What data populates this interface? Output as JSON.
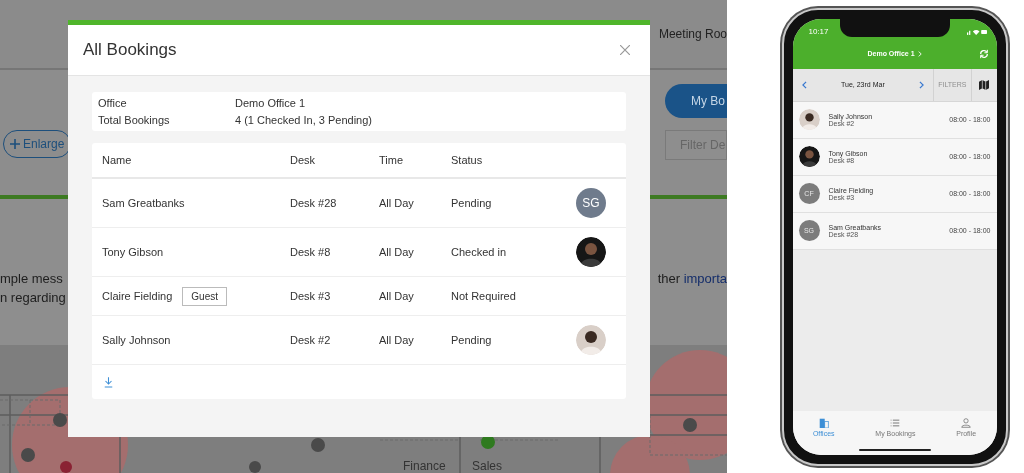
{
  "background_page": {
    "header_link": "Meeting Roo",
    "my_bookings_button": "My Bo",
    "enlarge_button": "Enlarge",
    "filter_field": {
      "placeholder": "Filter De"
    },
    "message_left": [
      "mple mess",
      "n regarding"
    ],
    "message_right": {
      "text": "ther",
      "link": "importa"
    },
    "floor_plan_labels": [
      "Finance",
      "Sales"
    ]
  },
  "modal": {
    "title": "All Bookings",
    "summary": [
      {
        "label": "Office",
        "value": "Demo Office 1"
      },
      {
        "label": "Total Bookings",
        "value": "4 (1 Checked In, 3 Pending)"
      }
    ],
    "table": {
      "columns": [
        "Name",
        "Desk",
        "Time",
        "Status"
      ],
      "rows": [
        {
          "name": "Sam Greatbanks",
          "desk": "Desk #28",
          "time": "All Day",
          "status": "Pending",
          "avatar": {
            "kind": "initials",
            "initials": "SG"
          }
        },
        {
          "name": "Tony Gibson",
          "desk": "Desk #8",
          "time": "All Day",
          "status": "Checked in",
          "avatar": {
            "kind": "darkphoto"
          }
        },
        {
          "name": "Claire Fielding",
          "badge": "Guest",
          "desk": "Desk #3",
          "time": "All Day",
          "status": "Not Required"
        },
        {
          "name": "Sally Johnson",
          "desk": "Desk #2",
          "time": "All Day",
          "status": "Pending",
          "avatar": {
            "kind": "lightphoto"
          }
        }
      ]
    }
  },
  "phone": {
    "status_time": "10:17",
    "office_title": "Demo Office 1",
    "date": "Tue, 23rd Mar",
    "filters_button": {
      "label": "FILTERS",
      "disabled": true
    },
    "bookings": [
      {
        "name": "Sally Johnson",
        "desk": "Desk #2",
        "time": "08:00 - 18:00",
        "avatar": {
          "kind": "lightphoto"
        }
      },
      {
        "name": "Tony Gibson",
        "desk": "Desk #8",
        "time": "08:00 - 18:00",
        "avatar": {
          "kind": "darkphoto"
        }
      },
      {
        "name": "Claire Fielding",
        "desk": "Desk #3",
        "time": "08:00 - 18:00",
        "avatar": {
          "kind": "initials",
          "initials": "CF"
        }
      },
      {
        "name": "Sam Greatbanks",
        "desk": "Desk #28",
        "time": "08:00 - 18:00",
        "avatar": {
          "kind": "initials",
          "initials": "SG"
        }
      }
    ],
    "tabs": [
      {
        "label": "Offices",
        "selected": true
      },
      {
        "label": "My Bookings",
        "selected": false
      },
      {
        "label": "Profile",
        "selected": false
      }
    ]
  }
}
